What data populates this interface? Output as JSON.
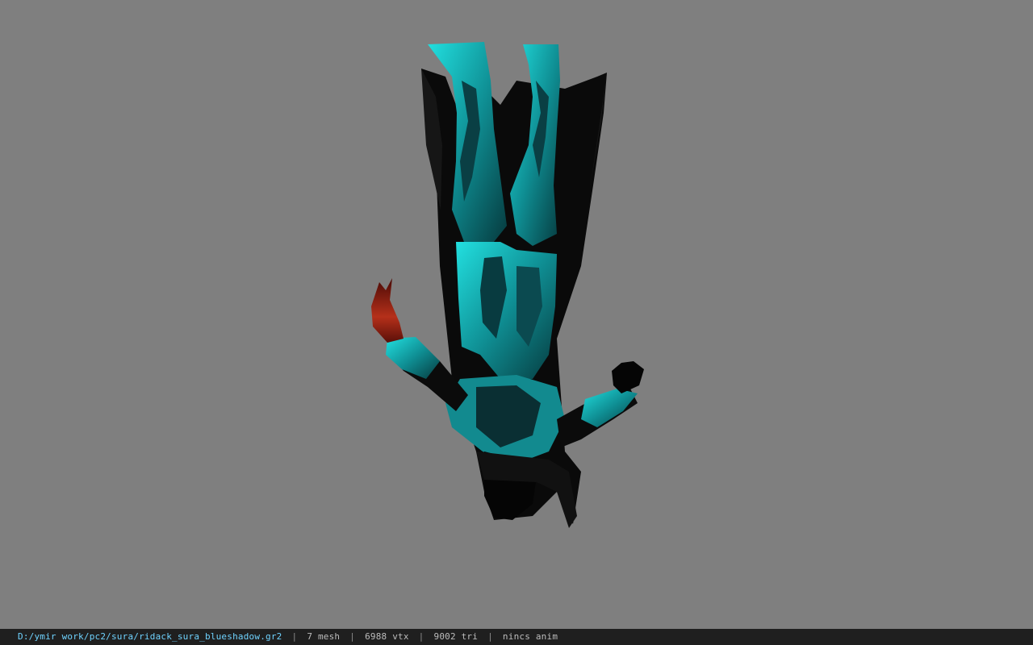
{
  "viewer": {
    "background_color": "#7f7f7f",
    "model_colors": {
      "armor": "#17c6c9",
      "armor_dark": "#0b4d52",
      "cape": "#0b0b0b",
      "flame": "#9a1f10"
    }
  },
  "status": {
    "file_path": "D:/ymir work/pc2/sura/ridack_sura_blueshadow.gr2",
    "mesh": "7 mesh",
    "vtx": "6988 vtx",
    "tri": "9002 tri",
    "anim": "nincs anim",
    "separator": "|"
  }
}
